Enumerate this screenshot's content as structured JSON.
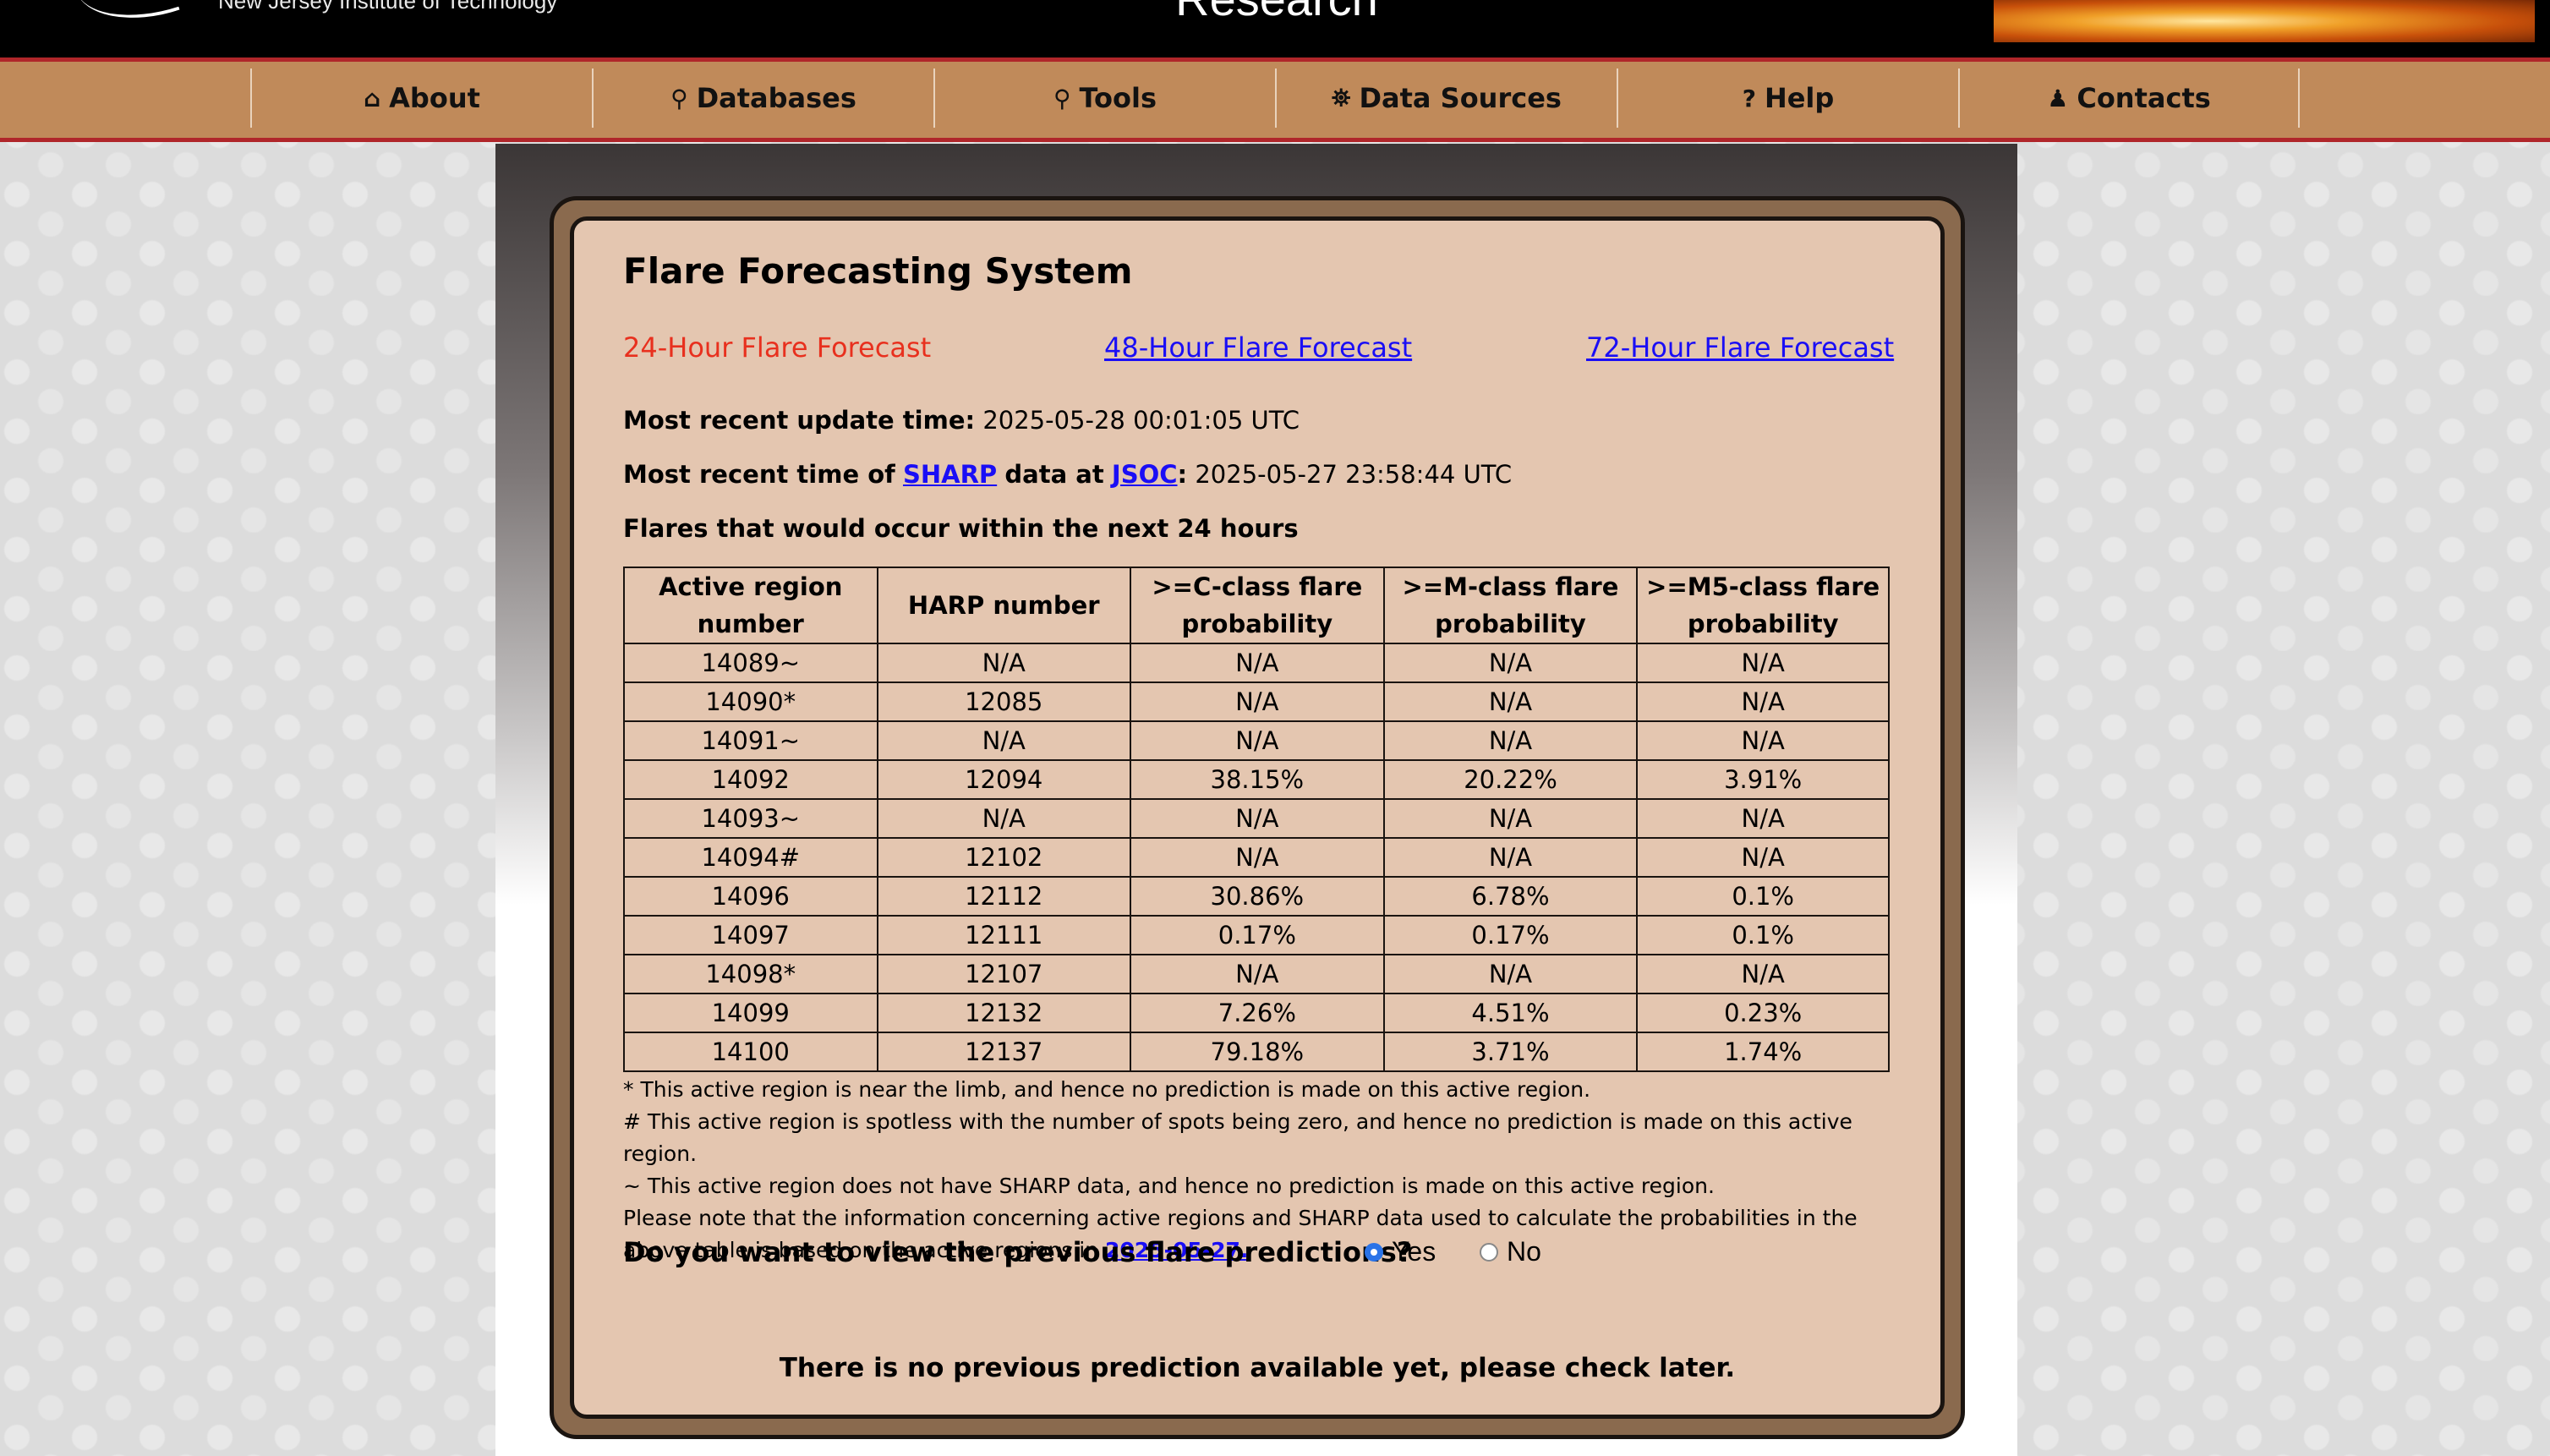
{
  "header": {
    "logo_text": "New Jersey Institute of Technology",
    "site_title": "Research"
  },
  "nav": {
    "items": [
      {
        "label": "About",
        "icon": "home-icon",
        "glyph": "⌂"
      },
      {
        "label": "Databases",
        "icon": "search-icon",
        "glyph": "⚲"
      },
      {
        "label": "Tools",
        "icon": "search-icon",
        "glyph": "⚲"
      },
      {
        "label": "Data Sources",
        "icon": "telescope-icon",
        "glyph": "⛯"
      },
      {
        "label": "Help",
        "icon": "help-circle-icon",
        "glyph": "?"
      },
      {
        "label": "Contacts",
        "icon": "user-icon",
        "glyph": "♟"
      }
    ]
  },
  "main": {
    "title": "Flare Forecasting System",
    "tabs": {
      "active": "24-Hour Flare Forecast",
      "forecast_48": "48-Hour Flare Forecast",
      "forecast_72": "72-Hour Flare Forecast"
    },
    "update": {
      "label": "Most recent update time:",
      "value": "2025-05-28 00:01:05 UTC"
    },
    "sharp": {
      "prefix": "Most recent time of",
      "sharp_link": "SHARP",
      "middle": "data at",
      "jsoc_link": "JSOC",
      "suffix": ":",
      "value": "2025-05-27 23:58:44 UTC"
    },
    "table_caption": "Flares that would occur within the next 24 hours",
    "table": {
      "headers": [
        "Active region number",
        "HARP number",
        ">=C-class flare probability",
        ">=M-class flare probability",
        ">=M5-class flare probability"
      ],
      "rows": [
        [
          "14089~",
          "N/A",
          "N/A",
          "N/A",
          "N/A"
        ],
        [
          "14090*",
          "12085",
          "N/A",
          "N/A",
          "N/A"
        ],
        [
          "14091~",
          "N/A",
          "N/A",
          "N/A",
          "N/A"
        ],
        [
          "14092",
          "12094",
          "38.15%",
          "20.22%",
          "3.91%"
        ],
        [
          "14093~",
          "N/A",
          "N/A",
          "N/A",
          "N/A"
        ],
        [
          "14094#",
          "12102",
          "N/A",
          "N/A",
          "N/A"
        ],
        [
          "14096",
          "12112",
          "30.86%",
          "6.78%",
          "0.1%"
        ],
        [
          "14097",
          "12111",
          "0.17%",
          "0.17%",
          "0.1%"
        ],
        [
          "14098*",
          "12107",
          "N/A",
          "N/A",
          "N/A"
        ],
        [
          "14099",
          "12132",
          "7.26%",
          "4.51%",
          "0.23%"
        ],
        [
          "14100",
          "12137",
          "79.18%",
          "3.71%",
          "1.74%"
        ]
      ]
    },
    "notes": {
      "star": "* This active region is near the limb, and hence no prediction is made on this active region.",
      "hash": "# This active region is spotless with the number of spots being zero, and hence no prediction is made on this active region.",
      "tilde": "~ This active region does not have SHARP data, and hence no prediction is made on this active region.",
      "please": "Please note that the information concerning active regions and SHARP data used to calculate the probabilities in the above table is based on the active regions in",
      "date_link": "2025-05-27."
    },
    "question": "Do you want to view the previous flare predictions?",
    "radio": {
      "yes": "Yes",
      "no": "No",
      "selected": "yes"
    },
    "no_previous": "There is no previous prediction available yet, please check later."
  },
  "colors": {
    "nav_bg": "#c08a5a",
    "nav_border": "#b0262a",
    "panel_bg": "#e4c6b0",
    "frame": "#8a6a4e",
    "active_tab": "#e8301e",
    "link": "#1a0ef5"
  }
}
